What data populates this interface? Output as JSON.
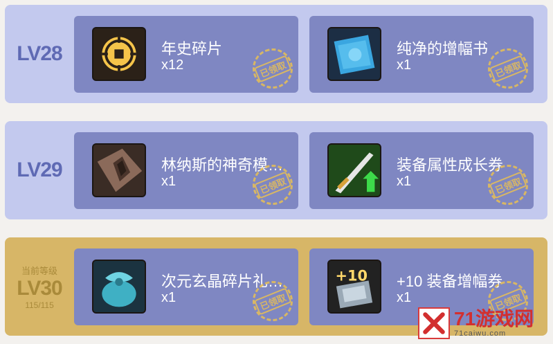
{
  "rows": [
    {
      "level": "LV28",
      "items": [
        {
          "name": "年史碎片",
          "qty": "x12",
          "icon": "coin-fragment-icon",
          "stamp": "已领取"
        },
        {
          "name": "纯净的增幅书",
          "qty": "x1",
          "icon": "amplify-book-icon",
          "stamp": "已领取"
        }
      ]
    },
    {
      "level": "LV29",
      "items": [
        {
          "name": "林纳斯的神奇模…",
          "qty": "x1",
          "icon": "mold-icon",
          "stamp": "已领取"
        },
        {
          "name": "装备属性成长券",
          "qty": "x1",
          "icon": "sword-upgrade-icon",
          "stamp": "已领取"
        }
      ]
    },
    {
      "level": "LV30",
      "current_label": "当前等级",
      "progress": "115/115",
      "items": [
        {
          "name": "次元玄晶碎片礼…",
          "qty": "x1",
          "icon": "crystal-pouch-icon",
          "stamp": "已领取"
        },
        {
          "name": "+10 装备增幅券",
          "qty": "x1",
          "icon": "plus10-ticket-icon",
          "stamp": "已领取"
        }
      ]
    }
  ],
  "watermark": {
    "main": "71游戏网",
    "sub": "71caiwu.com"
  },
  "colors": {
    "row": "#c3c9ee",
    "current_row": "#d7b667",
    "card": "#7f87c2",
    "stamp": "#e3bd5a",
    "level_text": "#5f6ab4"
  }
}
